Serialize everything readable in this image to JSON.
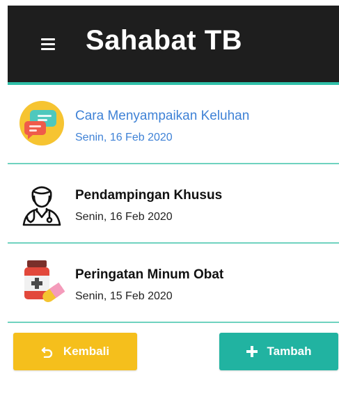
{
  "app": {
    "title": "Sahabat TB",
    "colors": {
      "appbar": "#1e1e1e",
      "accent": "#2fbfa8",
      "active_text": "#3f82d6",
      "back_button": "#f5bf1c",
      "add_button": "#21b3a1"
    }
  },
  "items": [
    {
      "title": "Cara Menyampaikan Keluhan",
      "date": "Senin, 16 Feb 2020",
      "icon": "chat-bubbles-icon",
      "active": true
    },
    {
      "title": "Pendampingan Khusus",
      "date": "Senin, 16 Feb 2020",
      "icon": "doctor-icon",
      "active": false
    },
    {
      "title": "Peringatan Minum Obat",
      "date": "Senin, 15 Feb 2020",
      "icon": "medicine-icon",
      "active": false
    }
  ],
  "buttons": {
    "back_label": "Kembali",
    "back_icon": "undo-icon",
    "add_label": "Tambah",
    "add_icon": "plus-icon"
  }
}
